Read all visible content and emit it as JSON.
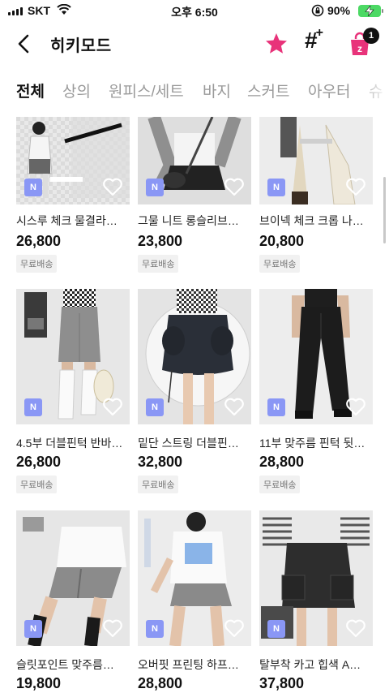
{
  "status_bar": {
    "carrier": "SKT",
    "time": "오후 6:50",
    "battery_percent": "90%"
  },
  "header": {
    "title": "히키모드",
    "cart_count": "1"
  },
  "tabs": [
    {
      "label": "전체",
      "active": true
    },
    {
      "label": "상의",
      "active": false
    },
    {
      "label": "원피스/세트",
      "active": false
    },
    {
      "label": "바지",
      "active": false
    },
    {
      "label": "스커트",
      "active": false
    },
    {
      "label": "아우터",
      "active": false
    },
    {
      "label": "슈",
      "active": false
    }
  ],
  "badge_label": "N",
  "products": [
    {
      "name": "시스루 체크 물결라…",
      "price": "26,800",
      "shipping": "무료배송"
    },
    {
      "name": "그물 니트 롱슬리브…",
      "price": "23,800",
      "shipping": "무료배송"
    },
    {
      "name": "브이넥 체크 크롭 나…",
      "price": "20,800",
      "shipping": "무료배송"
    },
    {
      "name": "4.5부 더블핀턱 반바…",
      "price": "26,800",
      "shipping": "무료배송"
    },
    {
      "name": "밑단 스트링 더블핀…",
      "price": "32,800",
      "shipping": "무료배송"
    },
    {
      "name": "11부 맞주름 핀턱 뒷…",
      "price": "28,800",
      "shipping": "무료배송"
    },
    {
      "name": "슬릿포인트 맞주름…",
      "price": "19,800",
      "shipping": ""
    },
    {
      "name": "오버핏 프린팅 하프…",
      "price": "28,800",
      "shipping": ""
    },
    {
      "name": "탈부착 카고 힙색 A…",
      "price": "37,800",
      "shipping": ""
    }
  ],
  "colors": {
    "accent_pink": "#e8337a",
    "badge_blue": "#8a97f5",
    "tab_inactive": "#9a9a9a"
  },
  "icons": [
    "back-arrow-icon",
    "star-icon",
    "hashtag-plus-icon",
    "shopping-bag-icon",
    "heart-icon"
  ]
}
